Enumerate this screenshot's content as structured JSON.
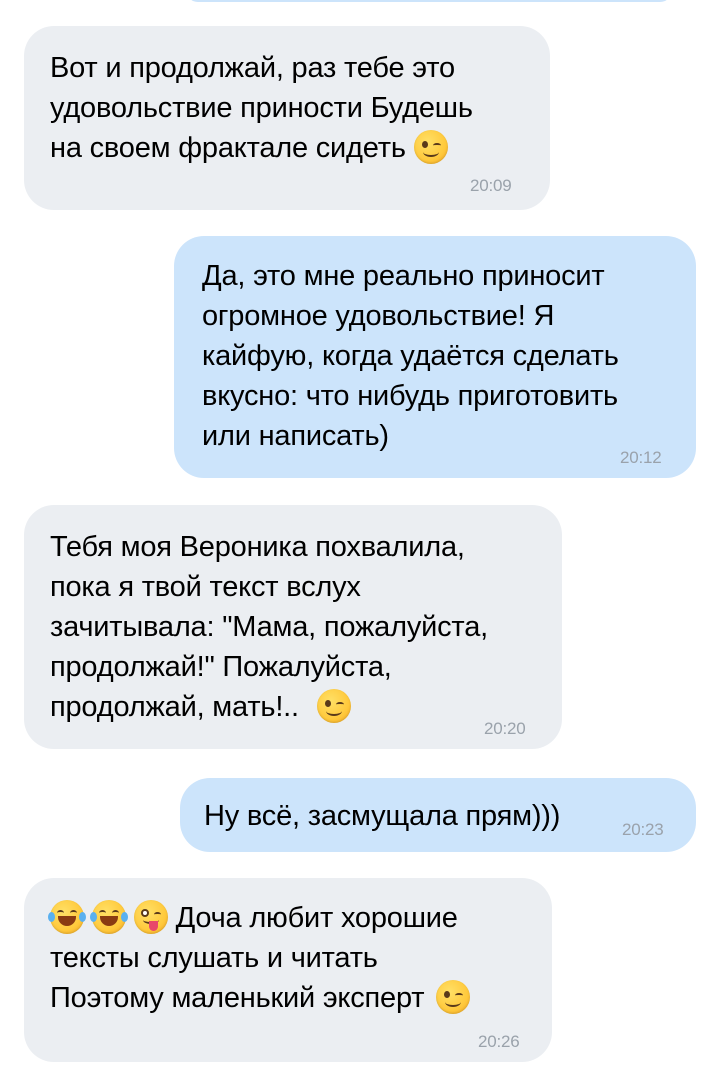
{
  "messages": [
    {
      "direction": "incoming",
      "lines": [
        "Вот и продолжай, раз тебе это",
        "удовольствие приности Будешь",
        "на своем фрактале сидеть"
      ],
      "trailing_emoji": "winking-face",
      "time": "20:09"
    },
    {
      "direction": "outgoing",
      "lines": [
        "Да, это мне реально приносит",
        "огромное удовольствие! Я",
        "кайфую, когда удаётся сделать",
        "вкусно: что нибудь приготовить",
        "или написать)"
      ],
      "time": "20:12"
    },
    {
      "direction": "incoming",
      "lines": [
        "Тебя моя Вероника похвалила,",
        "пока я твой текст вслух",
        "зачитывала: \"Мама, пожалуйста,",
        "продолжай!\" Пожалуйста,",
        "продолжай, мать!.."
      ],
      "trailing_emoji": "winking-face",
      "time": "20:20"
    },
    {
      "direction": "outgoing",
      "lines": [
        "Ну всё, засмущала прям)))"
      ],
      "time": "20:23"
    },
    {
      "direction": "incoming",
      "leading_emoji": [
        "face-with-tears-of-joy",
        "face-with-tears-of-joy",
        "winking-face-with-tongue"
      ],
      "lines": [
        "Доча любит хорошие",
        "тексты слушать и читать",
        "Поэтому маленький эксперт"
      ],
      "trailing_emoji": "winking-face",
      "time": "20:26"
    }
  ],
  "colors": {
    "incoming_bubble": "#ebeef2",
    "outgoing_bubble": "#cce4fb",
    "timestamp": "#9aa2ab",
    "text": "#000000"
  }
}
